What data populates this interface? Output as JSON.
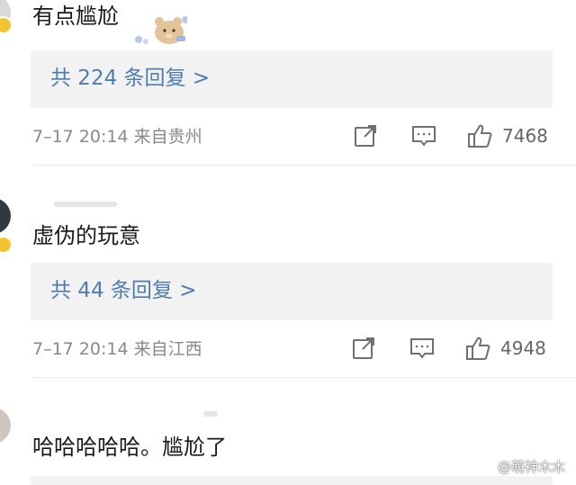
{
  "comments": [
    {
      "text": "有点尴尬",
      "reply_link": "共 224 条回复 >",
      "meta": "7–17 20:14 来自贵州",
      "likes": "7468"
    },
    {
      "text": "虚伪的玩意",
      "reply_link": "共 44 条回复 >",
      "meta": "7–17 20:14 来自江西",
      "likes": "4948"
    },
    {
      "text": "哈哈哈哈哈。尴尬了"
    }
  ],
  "icons": {
    "share": "share-icon",
    "comment": "comment-icon",
    "like": "thumbs-up-icon",
    "badge": "verified-badge-icon",
    "sticker": "bear-sticker-icon"
  },
  "colors": {
    "link": "#507daf",
    "meta": "#8a8a8a",
    "reply_bg": "#f2f2f2",
    "badge": "#f4c430"
  },
  "watermark": "@萌神木木"
}
